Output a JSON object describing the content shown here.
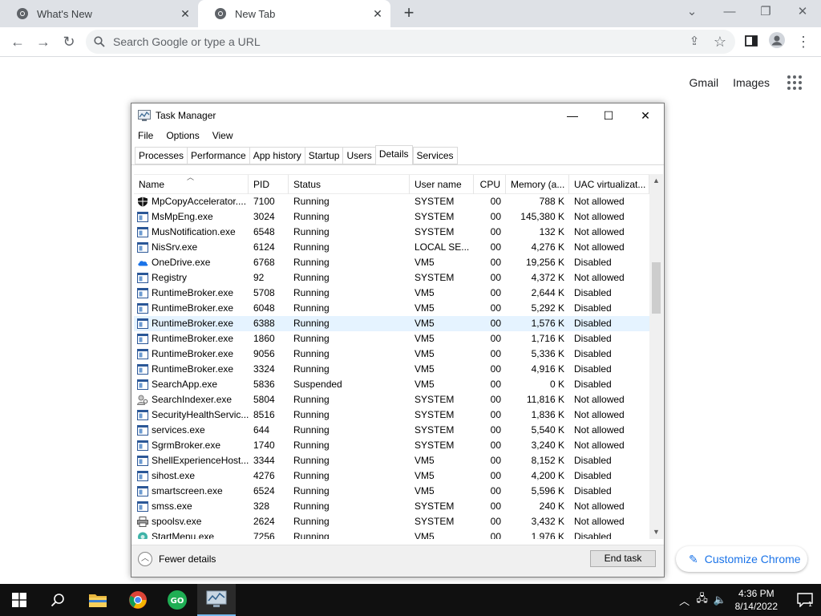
{
  "browser": {
    "tabs": [
      {
        "title": "What's New",
        "icon": "chrome-icon"
      },
      {
        "title": "New Tab",
        "icon": "chrome-icon"
      }
    ],
    "new_tab_symbol": "+",
    "window_controls": {
      "search_tabs": "⌄",
      "minimize": "—",
      "restore": "❐",
      "close": "✕"
    },
    "omnibox_placeholder": "Search Google or type a URL",
    "ntp_links": {
      "gmail": "Gmail",
      "images": "Images"
    },
    "customize_label": "Customize Chrome"
  },
  "task_manager": {
    "title": "Task Manager",
    "menu": [
      "File",
      "Options",
      "View"
    ],
    "tabs": [
      "Processes",
      "Performance",
      "App history",
      "Startup",
      "Users",
      "Details",
      "Services"
    ],
    "active_tab": "Details",
    "columns": [
      "Name",
      "PID",
      "Status",
      "User name",
      "CPU",
      "Memory (a...",
      "UAC virtualizat..."
    ],
    "rows": [
      {
        "name": "MpCopyAccelerator....",
        "pid": "7100",
        "status": "Running",
        "user": "SYSTEM",
        "cpu": "00",
        "mem": "788 K",
        "uac": "Not allowed",
        "icon": "shield-icon"
      },
      {
        "name": "MsMpEng.exe",
        "pid": "3024",
        "status": "Running",
        "user": "SYSTEM",
        "cpu": "00",
        "mem": "145,380 K",
        "uac": "Not allowed",
        "icon": "window-icon"
      },
      {
        "name": "MusNotification.exe",
        "pid": "6548",
        "status": "Running",
        "user": "SYSTEM",
        "cpu": "00",
        "mem": "132 K",
        "uac": "Not allowed",
        "icon": "window-icon"
      },
      {
        "name": "NisSrv.exe",
        "pid": "6124",
        "status": "Running",
        "user": "LOCAL SE...",
        "cpu": "00",
        "mem": "4,276 K",
        "uac": "Not allowed",
        "icon": "window-icon"
      },
      {
        "name": "OneDrive.exe",
        "pid": "6768",
        "status": "Running",
        "user": "VM5",
        "cpu": "00",
        "mem": "19,256 K",
        "uac": "Disabled",
        "icon": "cloud-icon"
      },
      {
        "name": "Registry",
        "pid": "92",
        "status": "Running",
        "user": "SYSTEM",
        "cpu": "00",
        "mem": "4,372 K",
        "uac": "Not allowed",
        "icon": "window-icon"
      },
      {
        "name": "RuntimeBroker.exe",
        "pid": "5708",
        "status": "Running",
        "user": "VM5",
        "cpu": "00",
        "mem": "2,644 K",
        "uac": "Disabled",
        "icon": "window-icon"
      },
      {
        "name": "RuntimeBroker.exe",
        "pid": "6048",
        "status": "Running",
        "user": "VM5",
        "cpu": "00",
        "mem": "5,292 K",
        "uac": "Disabled",
        "icon": "window-icon"
      },
      {
        "name": "RuntimeBroker.exe",
        "pid": "6388",
        "status": "Running",
        "user": "VM5",
        "cpu": "00",
        "mem": "1,576 K",
        "uac": "Disabled",
        "icon": "window-icon",
        "selected": true
      },
      {
        "name": "RuntimeBroker.exe",
        "pid": "1860",
        "status": "Running",
        "user": "VM5",
        "cpu": "00",
        "mem": "1,716 K",
        "uac": "Disabled",
        "icon": "window-icon"
      },
      {
        "name": "RuntimeBroker.exe",
        "pid": "9056",
        "status": "Running",
        "user": "VM5",
        "cpu": "00",
        "mem": "5,336 K",
        "uac": "Disabled",
        "icon": "window-icon"
      },
      {
        "name": "RuntimeBroker.exe",
        "pid": "3324",
        "status": "Running",
        "user": "VM5",
        "cpu": "00",
        "mem": "4,916 K",
        "uac": "Disabled",
        "icon": "window-icon"
      },
      {
        "name": "SearchApp.exe",
        "pid": "5836",
        "status": "Suspended",
        "user": "VM5",
        "cpu": "00",
        "mem": "0 K",
        "uac": "Disabled",
        "icon": "window-icon"
      },
      {
        "name": "SearchIndexer.exe",
        "pid": "5804",
        "status": "Running",
        "user": "SYSTEM",
        "cpu": "00",
        "mem": "11,816 K",
        "uac": "Not allowed",
        "icon": "person-search-icon"
      },
      {
        "name": "SecurityHealthServic...",
        "pid": "8516",
        "status": "Running",
        "user": "SYSTEM",
        "cpu": "00",
        "mem": "1,836 K",
        "uac": "Not allowed",
        "icon": "window-icon"
      },
      {
        "name": "services.exe",
        "pid": "644",
        "status": "Running",
        "user": "SYSTEM",
        "cpu": "00",
        "mem": "5,540 K",
        "uac": "Not allowed",
        "icon": "window-icon"
      },
      {
        "name": "SgrmBroker.exe",
        "pid": "1740",
        "status": "Running",
        "user": "SYSTEM",
        "cpu": "00",
        "mem": "3,240 K",
        "uac": "Not allowed",
        "icon": "window-icon"
      },
      {
        "name": "ShellExperienceHost....",
        "pid": "3344",
        "status": "Running",
        "user": "VM5",
        "cpu": "00",
        "mem": "8,152 K",
        "uac": "Disabled",
        "icon": "window-icon"
      },
      {
        "name": "sihost.exe",
        "pid": "4276",
        "status": "Running",
        "user": "VM5",
        "cpu": "00",
        "mem": "4,200 K",
        "uac": "Disabled",
        "icon": "window-icon"
      },
      {
        "name": "smartscreen.exe",
        "pid": "6524",
        "status": "Running",
        "user": "VM5",
        "cpu": "00",
        "mem": "5,596 K",
        "uac": "Disabled",
        "icon": "window-icon"
      },
      {
        "name": "smss.exe",
        "pid": "328",
        "status": "Running",
        "user": "SYSTEM",
        "cpu": "00",
        "mem": "240 K",
        "uac": "Not allowed",
        "icon": "window-icon"
      },
      {
        "name": "spoolsv.exe",
        "pid": "2624",
        "status": "Running",
        "user": "SYSTEM",
        "cpu": "00",
        "mem": "3,432 K",
        "uac": "Not allowed",
        "icon": "printer-icon"
      },
      {
        "name": "StartMenu.exe",
        "pid": "7256",
        "status": "Running",
        "user": "VM5",
        "cpu": "00",
        "mem": "1,976 K",
        "uac": "Disabled",
        "icon": "start-menu-icon"
      }
    ],
    "footer": {
      "fewer_details": "Fewer details",
      "end_task": "End task"
    }
  },
  "taskbar": {
    "items": [
      "windows-start-icon",
      "search-icon",
      "file-explorer-icon",
      "chrome-icon",
      "go-app-icon",
      "task-manager-icon"
    ],
    "clock_time": "4:36 PM",
    "clock_date": "8/14/2022",
    "notification_count": "1"
  }
}
